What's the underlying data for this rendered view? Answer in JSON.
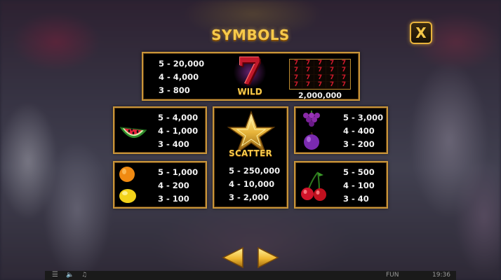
{
  "header": {
    "title": "SYMBOLS",
    "close_label": "X"
  },
  "wild_panel": {
    "payouts": [
      "5 - 20,000",
      "4 - 4,000",
      "3 - 800"
    ],
    "wild_label": "WILD",
    "seven_glyph": "7",
    "max_win": "2,000,000"
  },
  "scatter_panel": {
    "label": "SCATTER",
    "payouts": [
      "5 - 250,000",
      "4 - 10,000",
      "3 - 2,000"
    ]
  },
  "watermelon_panel": {
    "payouts": [
      "5 - 4,000",
      "4 - 1,000",
      "3 - 400"
    ]
  },
  "grape_plum_panel": {
    "payouts": [
      "5 - 3,000",
      "4 - 400",
      "3 - 200"
    ]
  },
  "orange_lemon_panel": {
    "payouts": [
      "5 - 1,000",
      "4 - 200",
      "3 - 100"
    ]
  },
  "cherry_panel": {
    "payouts": [
      "5 - 500",
      "4 - 100",
      "3 - 40"
    ]
  },
  "status_bar": {
    "mode": "FUN",
    "time": "19:36"
  },
  "colors": {
    "gold": "#f6c94a",
    "border": "#c8953a",
    "red": "#c0182a"
  }
}
